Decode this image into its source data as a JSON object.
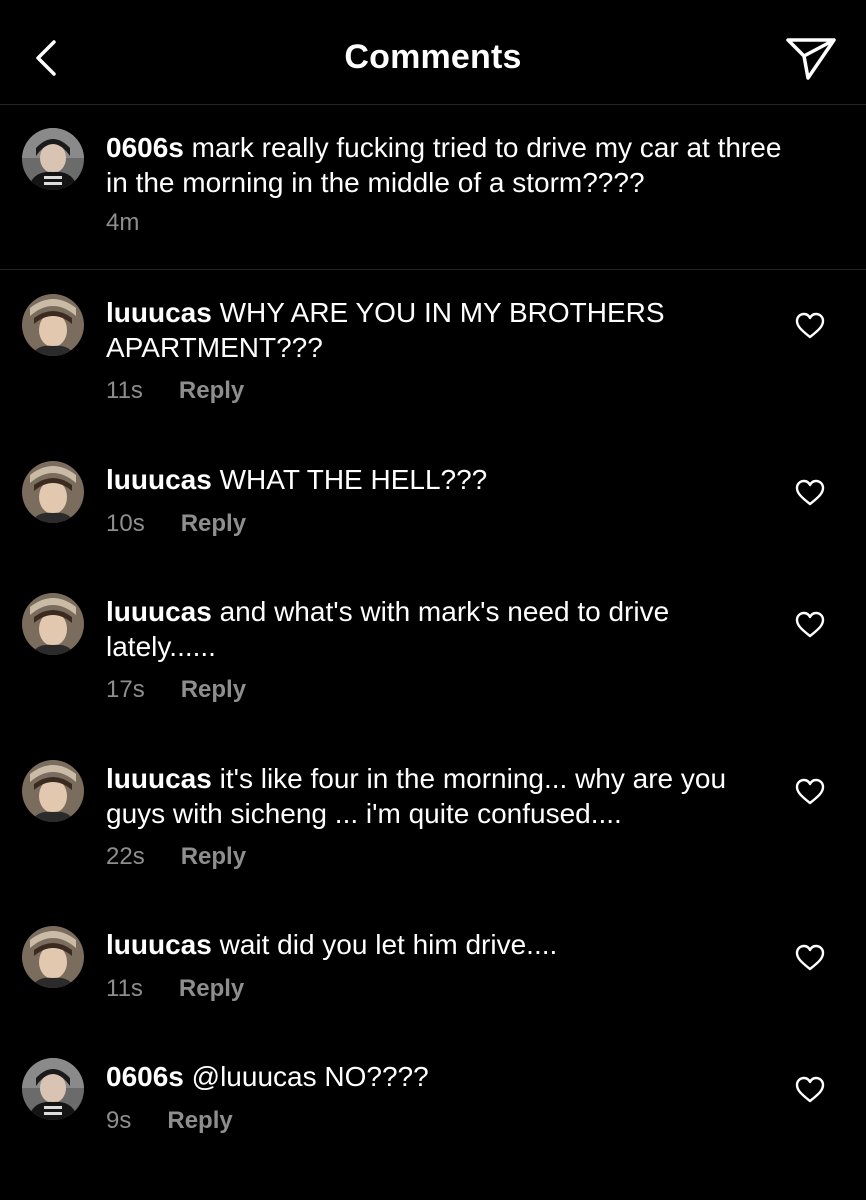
{
  "header": {
    "title": "Comments"
  },
  "caption": {
    "username": "0606s",
    "text": "mark really fucking tried to drive my car at three in the morning in the middle of a storm????",
    "time": "4m"
  },
  "reply_label": "Reply",
  "comments": [
    {
      "username": "luuucas",
      "text": "WHY ARE YOU IN MY BROTHERS APARTMENT???",
      "time": "11s"
    },
    {
      "username": "luuucas",
      "text": "WHAT THE HELL???",
      "time": "10s"
    },
    {
      "username": "luuucas",
      "text": "and what's with mark's need to drive lately......",
      "time": "17s"
    },
    {
      "username": "luuucas",
      "text": "it's like four in the morning... why are you guys with sicheng ... i'm quite confused....",
      "time": "22s"
    },
    {
      "username": "luuucas",
      "text": "wait did you let him drive....",
      "time": "11s"
    },
    {
      "username": "0606s",
      "text": "@luuucas NO????",
      "time": "9s"
    }
  ],
  "colors": {
    "background": "#000000",
    "text": "#ffffff",
    "secondary": "#8e8e8e",
    "divider": "#262626"
  }
}
